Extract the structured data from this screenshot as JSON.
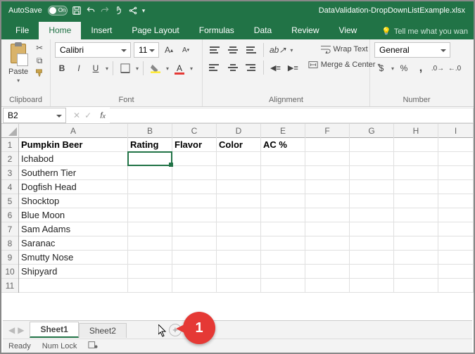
{
  "titlebar": {
    "autosave_label": "AutoSave",
    "autosave_state": "On",
    "filename": "DataValidation-DropDownListExample.xlsx"
  },
  "tabs": {
    "file": "File",
    "home": "Home",
    "insert": "Insert",
    "page_layout": "Page Layout",
    "formulas": "Formulas",
    "data": "Data",
    "review": "Review",
    "view": "View",
    "tell_me": "Tell me what you wan"
  },
  "ribbon": {
    "clipboard": {
      "paste": "Paste",
      "group": "Clipboard"
    },
    "font": {
      "name": "Calibri",
      "size": "11",
      "group": "Font"
    },
    "alignment": {
      "wrap": "Wrap Text",
      "merge": "Merge & Center",
      "group": "Alignment"
    },
    "number": {
      "format": "General",
      "group": "Number"
    }
  },
  "namebox": "B2",
  "columns": [
    "A",
    "B",
    "C",
    "D",
    "E",
    "F",
    "G",
    "H",
    "I"
  ],
  "rows": [
    "1",
    "2",
    "3",
    "4",
    "5",
    "6",
    "7",
    "8",
    "9",
    "10",
    "11"
  ],
  "headers": {
    "A": "Pumpkin Beer",
    "B": "Rating",
    "C": "Flavor",
    "D": "Color",
    "E": "AC %"
  },
  "dataA": [
    "Ichabod",
    "Southern Tier",
    "Dogfish Head",
    "Shocktop",
    "Blue Moon",
    "Sam Adams",
    "Saranac",
    "Smutty Nose",
    "Shipyard"
  ],
  "sheets": {
    "s1": "Sheet1",
    "s2": "Sheet2"
  },
  "status": {
    "ready": "Ready",
    "numlock": "Num Lock"
  },
  "callout": "1"
}
